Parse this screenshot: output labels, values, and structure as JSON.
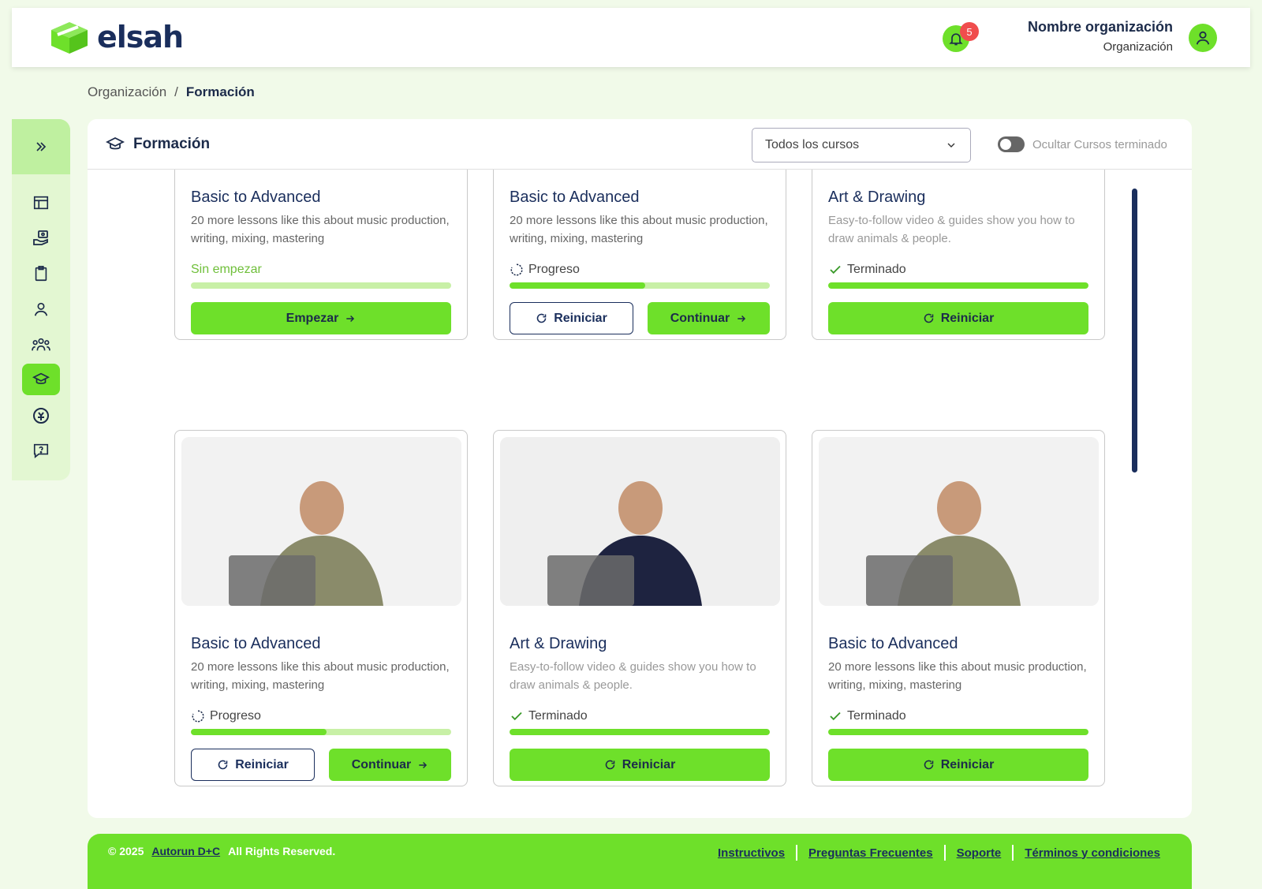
{
  "header": {
    "logo_text": "elsah",
    "notification_count": "5",
    "org_name": "Nombre organización",
    "org_role": "Organización"
  },
  "breadcrumb": {
    "root": "Organización",
    "separator": "/",
    "current": "Formación"
  },
  "sidebar": {
    "items": [
      {
        "icon": "layout-icon"
      },
      {
        "icon": "hand-money-icon"
      },
      {
        "icon": "clipboard-icon"
      },
      {
        "icon": "user-icon"
      },
      {
        "icon": "group-icon"
      },
      {
        "icon": "graduation-cap-icon",
        "active": true
      },
      {
        "icon": "medical-icon"
      },
      {
        "icon": "help-message-icon"
      }
    ]
  },
  "panel": {
    "title": "Formación",
    "course_filter": "Todos los cursos",
    "hide_finished_label": "Ocultar Cursos terminado"
  },
  "cards": [
    {
      "title": "Basic to Advanced",
      "desc": "20 more lessons like this about music production, writing, mixing, mastering",
      "status": "Sin empezar",
      "progress": 0,
      "buttons": [
        "Empezar"
      ]
    },
    {
      "title": "Basic to Advanced",
      "desc": "20 more lessons like this about music production, writing, mixing, mastering",
      "status": "Progreso",
      "progress": 0.52,
      "buttons": [
        "Reiniciar",
        "Continuar"
      ]
    },
    {
      "title": "Art & Drawing",
      "desc": "Easy-to-follow video & guides show you how to draw animals & people.",
      "status": "Terminado",
      "progress": 1,
      "buttons": [
        "Reiniciar"
      ]
    },
    {
      "title": "Basic to Advanced",
      "desc": "20 more lessons like this about music production, writing, mixing, mastering",
      "status": "Progreso",
      "progress": 0.52,
      "buttons": [
        "Reiniciar",
        "Continuar"
      ]
    },
    {
      "title": "Art & Drawing",
      "desc": "Easy-to-follow video & guides show you how to draw animals & people.",
      "status": "Terminado",
      "progress": 1,
      "buttons": [
        "Reiniciar"
      ]
    },
    {
      "title": "Basic to Advanced",
      "desc": "20 more lessons like this about music production, writing, mixing, mastering",
      "status": "Terminado",
      "progress": 1,
      "buttons": [
        "Reiniciar"
      ]
    }
  ],
  "footer": {
    "copyright": "© 2025",
    "company": "Autorun D+C",
    "rights": "All Rights Reserved.",
    "links": [
      "Instructivos",
      "Preguntas Frecuentes",
      "Soporte",
      "Términos y condiciones"
    ]
  },
  "colors": {
    "accent": "#6ee02a",
    "navy": "#1a2e5c",
    "badge": "#f04d4d"
  }
}
